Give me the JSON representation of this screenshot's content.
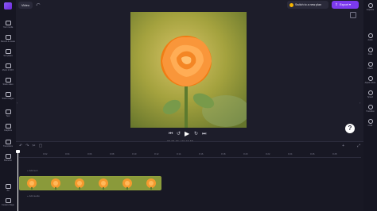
{
  "sidebar": {
    "items": [
      {
        "label": "Your media"
      },
      {
        "label": "Record & create"
      },
      {
        "label": "Templates"
      },
      {
        "label": "Music & SFX"
      },
      {
        "label": "Stock video"
      },
      {
        "label": "Stock images"
      },
      {
        "label": "Text"
      },
      {
        "label": "Graphics"
      },
      {
        "label": "Transitions"
      },
      {
        "label": "Brand kit"
      }
    ],
    "bottom": [
      {
        "label": "Aa"
      },
      {
        "label": "Feature Flags"
      }
    ]
  },
  "header": {
    "tab_label": "Video",
    "switch_label": "Switch to a new plan",
    "export_label": "Export",
    "export_chevron": "▾"
  },
  "right_sidebar": {
    "items": [
      {
        "label": "Captions"
      },
      {
        "label": "Audio"
      },
      {
        "label": "Fade"
      },
      {
        "label": "Filters"
      },
      {
        "label": "Adjust colors"
      },
      {
        "label": "Speed"
      },
      {
        "label": "Transition"
      },
      {
        "label": "Color"
      }
    ]
  },
  "playback": {
    "time_current": "00:00.00",
    "time_total": "00:12.03",
    "time_sep": " / "
  },
  "timeline": {
    "ticks": [
      "0:02",
      "0:04",
      "0:06",
      "0:08",
      "0:10",
      "0:12",
      "0:14",
      "0:16",
      "0:18",
      "0:20",
      "0:22",
      "0:24",
      "0:26",
      "0:28"
    ],
    "text_track": "+ Add text",
    "audio_track": "+ Add audio"
  },
  "help": {
    "label": "?"
  },
  "colors": {
    "accent": "#7c3aed",
    "background": "#1d1d2a",
    "clip": "#6c7a2e"
  }
}
